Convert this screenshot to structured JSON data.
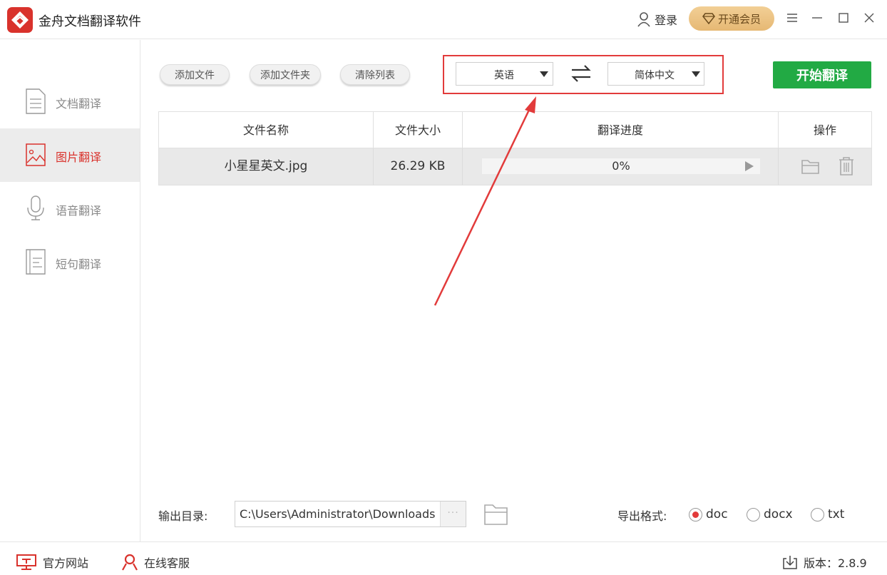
{
  "app": {
    "title": "金舟文档翻译软件"
  },
  "header": {
    "login_label": "登录",
    "vip_label": "开通会员"
  },
  "sidebar": {
    "items": [
      {
        "label": "文档翻译",
        "active": false
      },
      {
        "label": "图片翻译",
        "active": true
      },
      {
        "label": "语音翻译",
        "active": false
      },
      {
        "label": "短句翻译",
        "active": false
      }
    ]
  },
  "toolbar": {
    "add_file": "添加文件",
    "add_folder": "添加文件夹",
    "clear_list": "清除列表",
    "source_lang": "英语",
    "target_lang": "简体中文",
    "start_label": "开始翻译"
  },
  "table": {
    "columns": [
      "文件名称",
      "文件大小",
      "翻译进度",
      "操作"
    ],
    "rows": [
      {
        "name": "小星星英文.jpg",
        "size": "26.29 KB",
        "progress_text": "0%",
        "progress": 0
      }
    ]
  },
  "output": {
    "label": "输出目录:",
    "path": "C:\\Users\\Administrator\\Downloads",
    "dots": "···",
    "format_label": "导出格式:",
    "formats": [
      {
        "label": "doc",
        "checked": true
      },
      {
        "label": "docx",
        "checked": false
      },
      {
        "label": "txt",
        "checked": false
      }
    ]
  },
  "statusbar": {
    "website": "官方网站",
    "support": "在线客服",
    "version": "版本：2.8.9"
  },
  "colors": {
    "accent_red": "#d9322c",
    "green": "#22aa44",
    "vip_gold": "#e6b874",
    "annotation": "#e23b3b"
  }
}
